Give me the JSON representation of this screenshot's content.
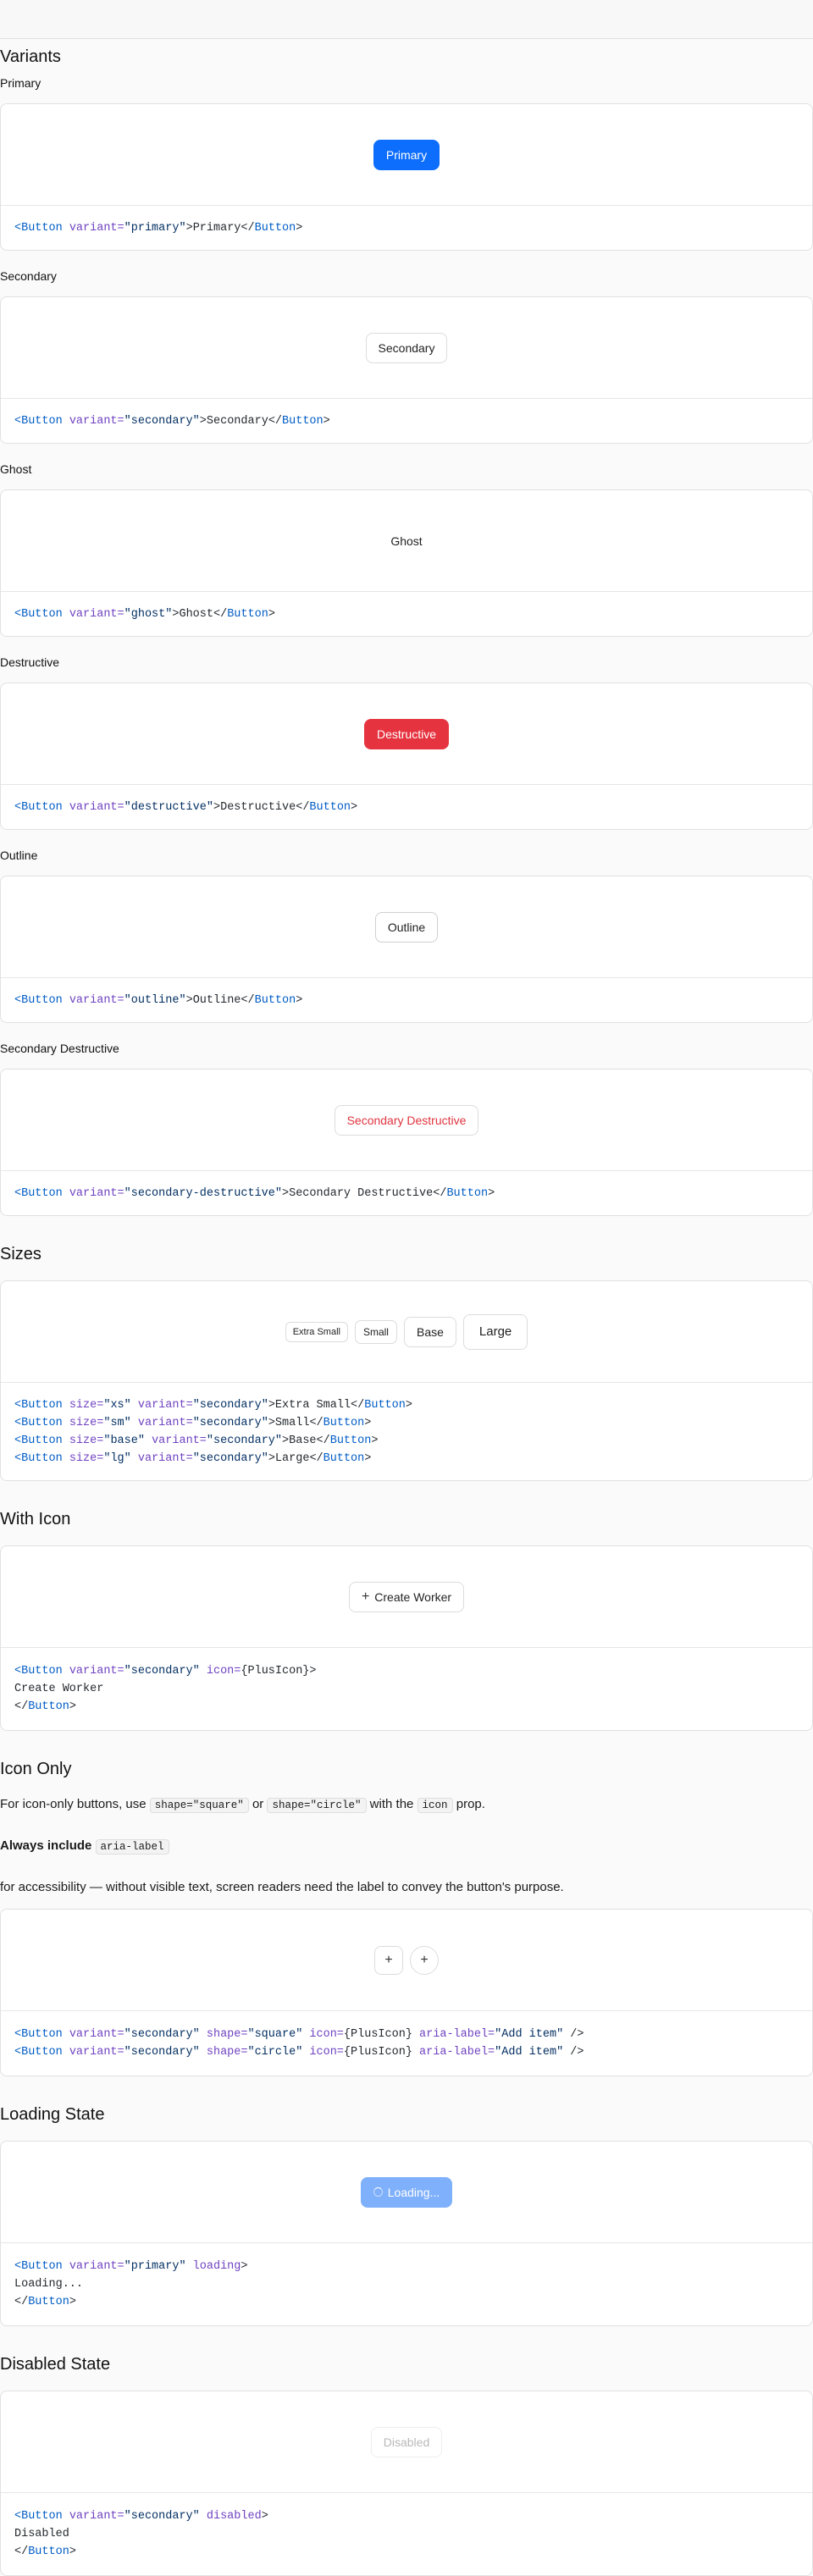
{
  "sections": {
    "variants": "Variants",
    "sizes": "Sizes",
    "with_icon": "With Icon",
    "icon_only": "Icon Only",
    "loading": "Loading State",
    "disabled": "Disabled State"
  },
  "variants": [
    {
      "label": "Primary",
      "button": "Primary",
      "code_variant": "primary",
      "code_text": "Primary"
    },
    {
      "label": "Secondary",
      "button": "Secondary",
      "code_variant": "secondary",
      "code_text": "Secondary"
    },
    {
      "label": "Ghost",
      "button": "Ghost",
      "code_variant": "ghost",
      "code_text": "Ghost"
    },
    {
      "label": "Destructive",
      "button": "Destructive",
      "code_variant": "destructive",
      "code_text": "Destructive"
    },
    {
      "label": "Outline",
      "button": "Outline",
      "code_variant": "outline",
      "code_text": "Outline"
    },
    {
      "label": "Secondary Destructive",
      "button": "Secondary Destructive",
      "code_variant": "secondary-destructive",
      "code_text": "Secondary Destructive"
    }
  ],
  "sizes": {
    "buttons": [
      "Extra Small",
      "Small",
      "Base",
      "Large"
    ],
    "codes": [
      {
        "size": "xs",
        "text": "Extra Small"
      },
      {
        "size": "sm",
        "text": "Small"
      },
      {
        "size": "base",
        "text": "Base"
      },
      {
        "size": "lg",
        "text": "Large"
      }
    ]
  },
  "with_icon": {
    "button": "Create Worker",
    "icon": "plus-icon",
    "code_line2": "Create Worker"
  },
  "icon_only": {
    "p1_before": "For icon-only buttons, use ",
    "p1_code1": "shape=\"square\"",
    "p1_or": " or ",
    "p1_code2": "shape=\"circle\"",
    "p1_with": " with the ",
    "p1_code3": "icon",
    "p1_after": " prop.",
    "p2_strong": "Always include",
    "p2_code": "aria-label",
    "p3": "for accessibility — without visible text, screen readers need the label to convey the button's purpose.",
    "aria_label": "Add item"
  },
  "loading": {
    "button": "Loading...",
    "code_line2": "Loading..."
  },
  "disabled": {
    "button": "Disabled",
    "code_line2": "Disabled"
  },
  "colors": {
    "primary": "#0d6efd",
    "destructive": "#e5333f",
    "loading": "#7fb0fb",
    "code_tag": "#005cc5",
    "code_attr": "#6f42c1",
    "code_string": "#032f62"
  }
}
